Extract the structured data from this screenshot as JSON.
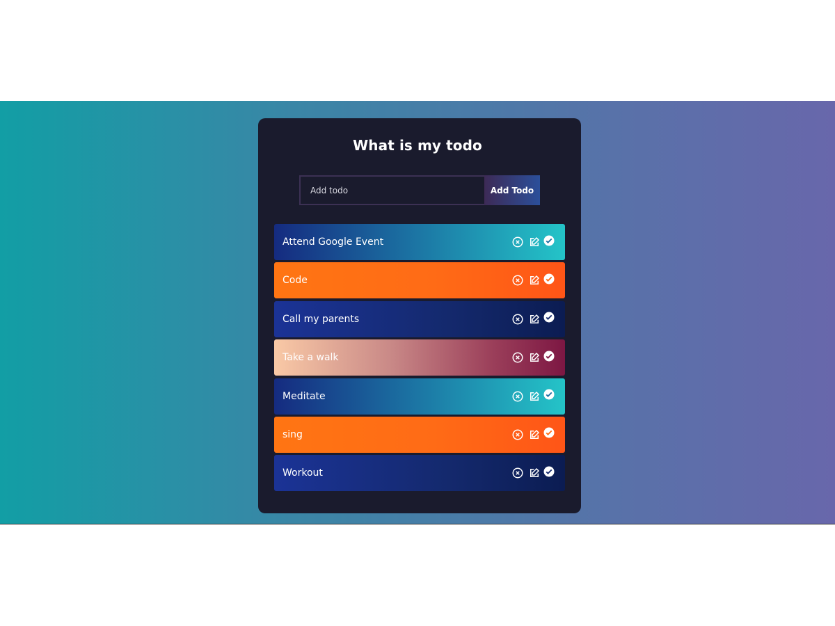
{
  "app": {
    "title": "What is my todo"
  },
  "form": {
    "input_placeholder": "Add todo",
    "input_value": "",
    "add_button_label": "Add Todo"
  },
  "todos": [
    {
      "text": "Attend Google Event",
      "theme": "teal"
    },
    {
      "text": "Code",
      "theme": "orange"
    },
    {
      "text": "Call my parents",
      "theme": "navy"
    },
    {
      "text": "Take a walk",
      "theme": "peach"
    },
    {
      "text": "Meditate",
      "theme": "teal"
    },
    {
      "text": "sing",
      "theme": "orange"
    },
    {
      "text": "Workout",
      "theme": "navy"
    }
  ],
  "icons": {
    "delete": "close-circle-icon",
    "edit": "edit-icon",
    "complete": "check-circle-icon"
  },
  "colors": {
    "card_background": "#1a1b2d",
    "band_left": "#129ea5",
    "band_right": "#6867ab",
    "text": "#ffffff"
  }
}
